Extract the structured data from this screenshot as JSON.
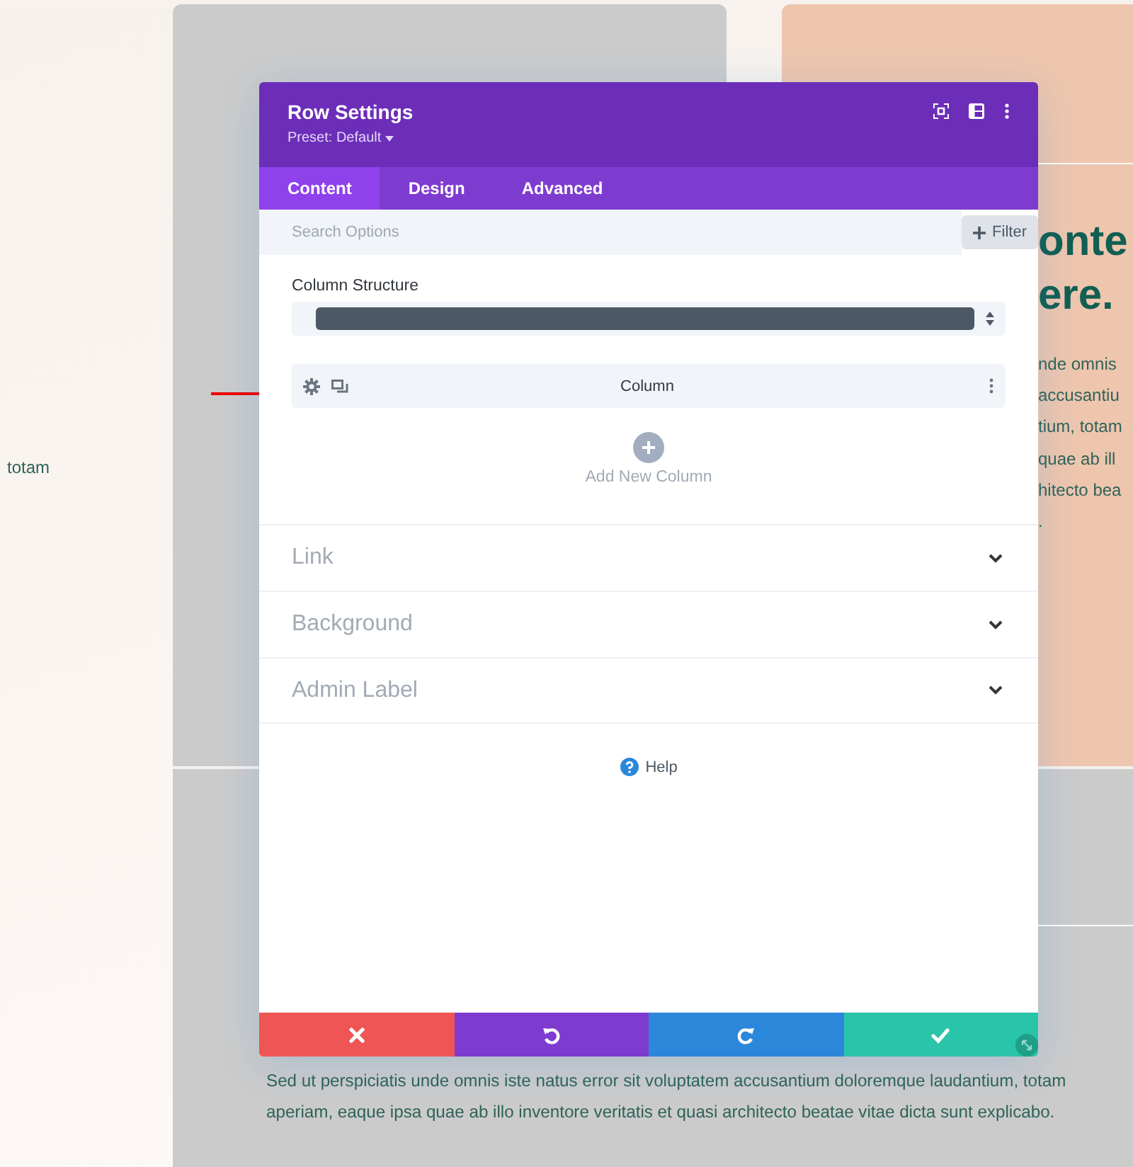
{
  "page": {
    "left_text": "totam",
    "heading_lines": [
      "onte",
      "ere."
    ],
    "body_lines": [
      "nde omnis",
      "accusantiu",
      "tium, totam",
      "quae ab ill",
      "hitecto bea",
      "."
    ],
    "bottom_lines": [
      "Sed ut perspiciatis unde omnis iste natus error sit voluptatem accusantium doloremque laudantium, totam",
      "aperiam, eaque ipsa quae ab illo inventore veritatis et quasi architecto beatae vitae dicta sunt explicabo."
    ]
  },
  "modal": {
    "title": "Row Settings",
    "preset": "Preset: Default",
    "tabs": [
      {
        "label": "Content",
        "selected": true
      },
      {
        "label": "Design",
        "selected": false
      },
      {
        "label": "Advanced",
        "selected": false
      }
    ],
    "search": {
      "placeholder": "Search Options"
    },
    "filter_button": "Filter",
    "column_structure": {
      "label": "Column Structure"
    },
    "columns": [
      {
        "label": "Column"
      }
    ],
    "add_column": "Add New Column",
    "sections": [
      {
        "label": "Link"
      },
      {
        "label": "Background"
      },
      {
        "label": "Admin Label"
      }
    ],
    "help": "Help",
    "footer_buttons": [
      {
        "kind": "discard"
      },
      {
        "kind": "undo"
      },
      {
        "kind": "redo"
      },
      {
        "kind": "save"
      }
    ]
  }
}
